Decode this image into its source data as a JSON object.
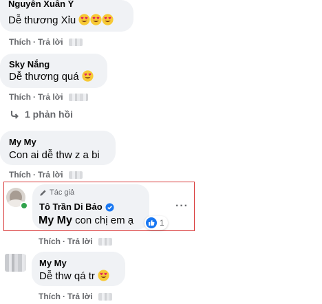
{
  "colors": {
    "bubble": "#f0f2f5",
    "meta_text": "#65676b",
    "like_blue": "#1877f2",
    "highlight_border": "#d93a3a",
    "online_green": "#31a24c"
  },
  "comments": [
    {
      "author": "Nguyễn Xuân Ý",
      "text": "Dễ thương Xỉu",
      "emoji": "heart-eyes-emoji x3",
      "like_label": "Thích",
      "reply_label": "Trả lời"
    },
    {
      "author": "Sky Nắng",
      "text": "Dễ thương quá",
      "emoji": "heart-eyes-emoji",
      "like_label": "Thích",
      "reply_label": "Trả lời",
      "replies_label": "1 phản hồi"
    },
    {
      "author": "My My",
      "text": "Con ai dễ thw z a bi",
      "like_label": "Thích",
      "reply_label": "Trả lời"
    }
  ],
  "author_reply": {
    "badge": "Tác giả",
    "author": "Tô Trần Di Bảo",
    "mention": "My My",
    "text": " con chị em ạ",
    "reaction_count": "1",
    "more_label": "···",
    "like_label": "Thích",
    "reply_label": "Trả lời"
  },
  "last_comment": {
    "author": "My My",
    "text": "Dễ thw qá tr",
    "emoji": "heart-eyes-emoji",
    "like_label": "Thích",
    "reply_label": "Trả lời"
  }
}
